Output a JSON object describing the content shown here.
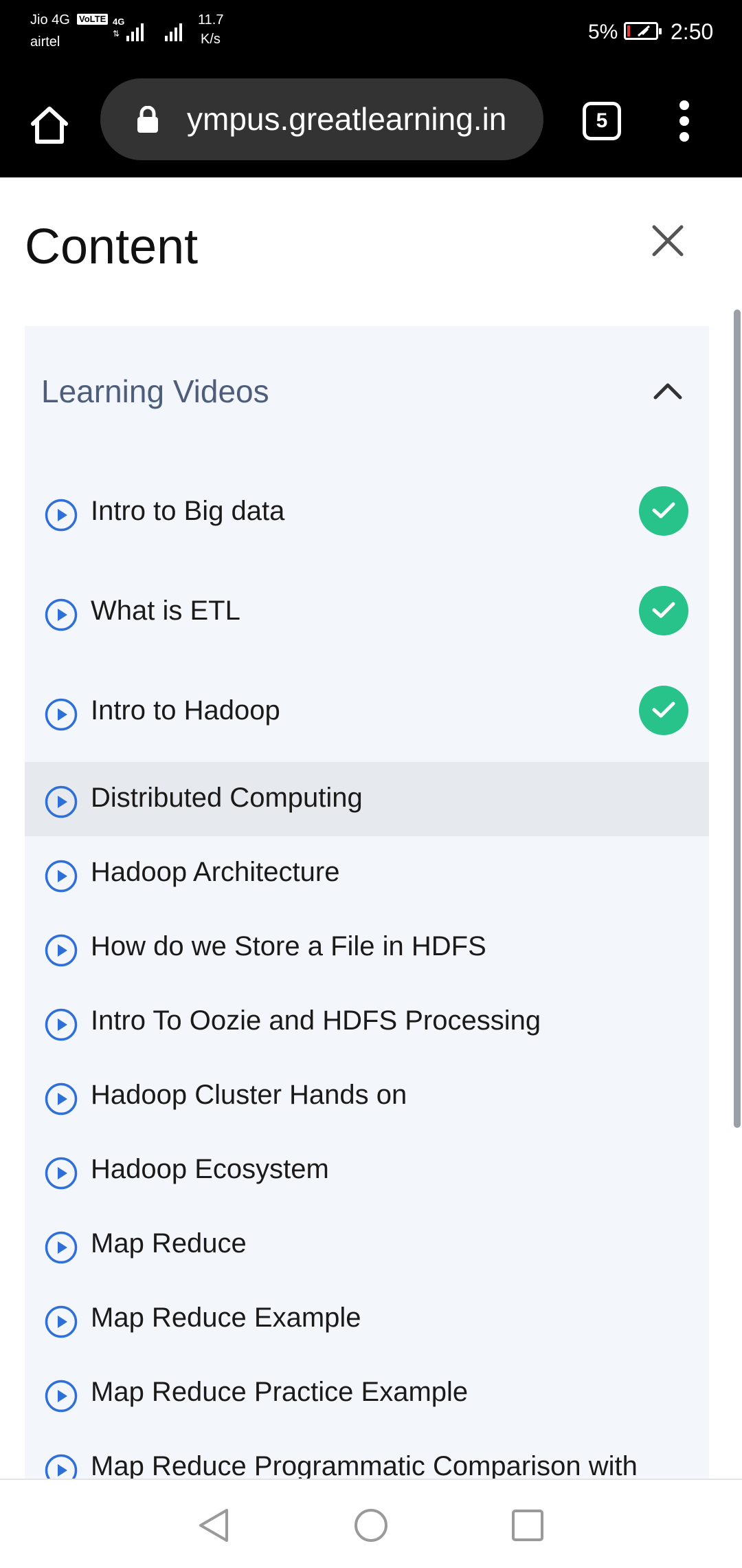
{
  "status_bar": {
    "carrier_primary": "Jio 4G",
    "volte": "VoLTE",
    "network_type": "4G",
    "carrier_secondary": "airtel",
    "data_speed_value": "11.7",
    "data_speed_unit": "K/s",
    "battery_percent": "5%",
    "time": "2:50",
    "battery_level": 0.05,
    "battery_color": "#e53935"
  },
  "browser": {
    "url": "ympus.greatlearning.in",
    "tab_count": "5",
    "icons": [
      "home-icon",
      "lock-icon",
      "tabs-icon",
      "overflow-menu-icon"
    ]
  },
  "page": {
    "title": "Content",
    "close_icon": "close-icon",
    "section": {
      "title": "Learning Videos",
      "expanded": true,
      "items": [
        {
          "label": "Intro to Big data",
          "completed": true
        },
        {
          "label": "What is ETL",
          "completed": true
        },
        {
          "label": "Intro to Hadoop",
          "completed": true
        },
        {
          "label": "Distributed Computing",
          "completed": false,
          "active": true
        },
        {
          "label": "Hadoop Architecture",
          "completed": false
        },
        {
          "label": "How do we Store a File in HDFS",
          "completed": false
        },
        {
          "label": "Intro To Oozie and HDFS Processing",
          "completed": false
        },
        {
          "label": "Hadoop Cluster Hands on",
          "completed": false
        },
        {
          "label": "Hadoop Ecosystem",
          "completed": false
        },
        {
          "label": "Map Reduce",
          "completed": false
        },
        {
          "label": "Map Reduce Example",
          "completed": false
        },
        {
          "label": "Map Reduce Practice Example",
          "completed": false
        },
        {
          "label": "Map Reduce Programmatic Comparison with",
          "completed": false
        }
      ]
    },
    "colors": {
      "accent_play": "#2f6fd8",
      "check": "#27c38a",
      "section_title": "#4d5d7a",
      "panel": "#f3f6fb",
      "active_row": "#e6e9ee"
    }
  },
  "nav_bar": {
    "buttons": [
      "back-icon",
      "home-circle-icon",
      "recents-icon"
    ]
  }
}
